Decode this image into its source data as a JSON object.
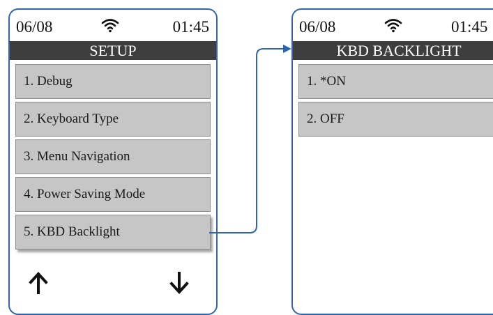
{
  "left_screen": {
    "status": {
      "date": "06/08",
      "time": "01:45"
    },
    "title": "SETUP",
    "items": [
      {
        "label": "1. Debug"
      },
      {
        "label": "2. Keyboard Type"
      },
      {
        "label": "3. Menu Navigation"
      },
      {
        "label": "4. Power Saving Mode"
      },
      {
        "label": "5. KBD Backlight"
      }
    ],
    "icons": {
      "status": "wifi-icon",
      "nav_up": "arrow-up-icon",
      "nav_down": "arrow-down-icon"
    }
  },
  "right_screen": {
    "status": {
      "date": "06/08",
      "time": "01:45"
    },
    "title": "KBD BACKLIGHT",
    "items": [
      {
        "label": "1. *ON"
      },
      {
        "label": "2. OFF"
      }
    ],
    "icons": {
      "status": "wifi-icon"
    }
  },
  "colors": {
    "frame": "#3566a8",
    "title_bar": "#3e3e3e",
    "menu_item": "#c6c6c6",
    "connector": "#2e63b0"
  }
}
